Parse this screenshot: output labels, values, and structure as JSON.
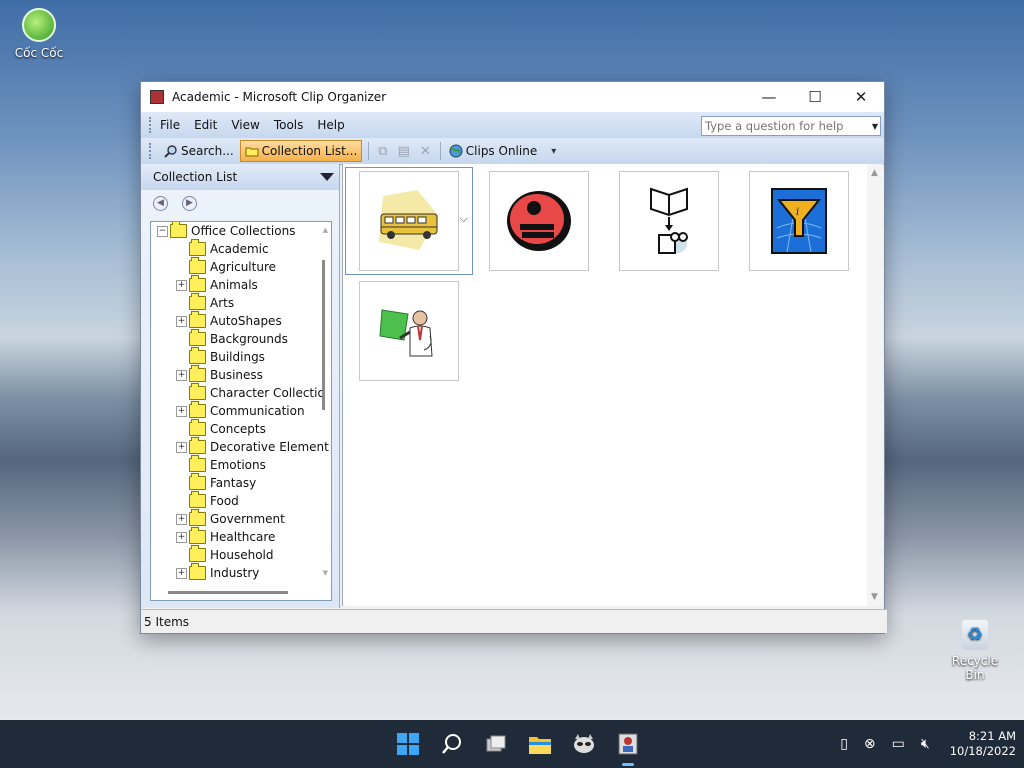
{
  "desktop": {
    "icons": [
      {
        "label": "Cốc Cốc"
      },
      {
        "label": "Recycle Bin"
      }
    ]
  },
  "window": {
    "title": "Academic - Microsoft Clip Organizer",
    "controls": {
      "minimize": "—",
      "maximize": "☐",
      "close": "✕"
    }
  },
  "menubar": {
    "items": [
      {
        "label": "File"
      },
      {
        "label": "Edit"
      },
      {
        "label": "View"
      },
      {
        "label": "Tools"
      },
      {
        "label": "Help"
      }
    ],
    "help_placeholder": "Type a question for help"
  },
  "toolbar": {
    "search_label": "Search...",
    "collection_list_label": "Collection List...",
    "clips_online_label": "Clips Online"
  },
  "collection_pane": {
    "title": "Collection List",
    "root": "Office Collections",
    "items": [
      {
        "label": "Academic",
        "expandable": false
      },
      {
        "label": "Agriculture",
        "expandable": false
      },
      {
        "label": "Animals",
        "expandable": true
      },
      {
        "label": "Arts",
        "expandable": false
      },
      {
        "label": "AutoShapes",
        "expandable": true
      },
      {
        "label": "Backgrounds",
        "expandable": false
      },
      {
        "label": "Buildings",
        "expandable": false
      },
      {
        "label": "Business",
        "expandable": true
      },
      {
        "label": "Character Collectio",
        "expandable": false
      },
      {
        "label": "Communication",
        "expandable": true
      },
      {
        "label": "Concepts",
        "expandable": false
      },
      {
        "label": "Decorative Element",
        "expandable": true
      },
      {
        "label": "Emotions",
        "expandable": false
      },
      {
        "label": "Fantasy",
        "expandable": false
      },
      {
        "label": "Food",
        "expandable": false
      },
      {
        "label": "Government",
        "expandable": true
      },
      {
        "label": "Healthcare",
        "expandable": true
      },
      {
        "label": "Household",
        "expandable": false
      },
      {
        "label": "Industry",
        "expandable": true
      }
    ]
  },
  "clips": [
    {
      "icon": "school-bus-icon"
    },
    {
      "icon": "student-books-icon"
    },
    {
      "icon": "book-camera-icon"
    },
    {
      "icon": "funnel-info-icon"
    },
    {
      "icon": "teacher-board-icon"
    }
  ],
  "status": {
    "text": "5 Items"
  },
  "taskbar": {
    "time": "8:21 AM",
    "date": "10/18/2022"
  }
}
